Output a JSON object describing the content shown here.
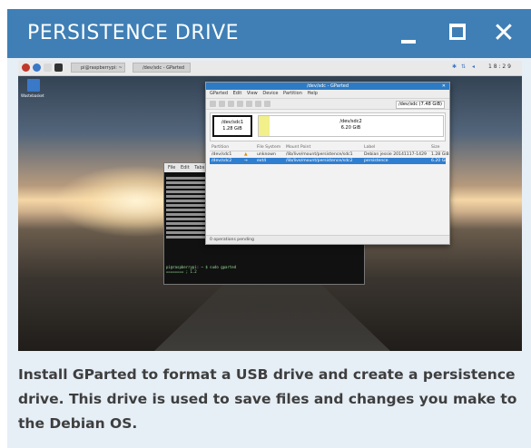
{
  "window": {
    "title": "PERSISTENCE DRIVE",
    "buttons": {
      "minimize_icon": "minimize-icon",
      "maximize_icon": "maximize-icon",
      "close_glyph": "✕"
    }
  },
  "screenshot": {
    "taskbar": {
      "tasks": [
        "pi@raspberrypi: ~",
        "/dev/sdc - GParted"
      ],
      "tray_time": "1 8 : 2 9"
    },
    "desktop": {
      "trash_label": "Wastebasket"
    },
    "terminal": {
      "menu": [
        "File",
        "Edit",
        "Tabs"
      ],
      "prompt_lines": [
        "pi@raspberrypi: ~ $ sudo gparted",
        "======== ; 1.2"
      ]
    },
    "gparted": {
      "title": "/dev/sdc - GParted",
      "menu": [
        "GParted",
        "Edit",
        "View",
        "Device",
        "Partition",
        "Help"
      ],
      "device_selector": "/dev/sdc  (7.48 GiB)",
      "partitions_graphic": [
        {
          "name": "/dev/sdc1",
          "size": "1.28 GiB"
        },
        {
          "name": "/dev/sdc2",
          "size": "6.20 GiB"
        }
      ],
      "table": {
        "headers": [
          "Partition",
          "File System",
          "Mount Point",
          "Label",
          "Size"
        ],
        "rows": [
          {
            "partition": "/dev/sdc1",
            "fs": "unknown",
            "mount": "/lib/live/mount/persistence/sdc1",
            "label": "Debian jessie 20141117-1429",
            "size": "1.28 GiB"
          },
          {
            "partition": "/dev/sdc2",
            "fs": "ext4",
            "mount": "/lib/live/mount/persistence/sdc2",
            "label": "persistence",
            "size": "6.20 GiB"
          }
        ]
      },
      "status": "0 operations pending"
    }
  },
  "caption": "Install GParted to format a USB drive and create a persistence drive. This drive is used to save files and changes you make to the Debian OS.",
  "colors": {
    "titlebar": "#3f7fb6",
    "panel": "#e6eef6",
    "caption_text": "#3e3e3e"
  }
}
